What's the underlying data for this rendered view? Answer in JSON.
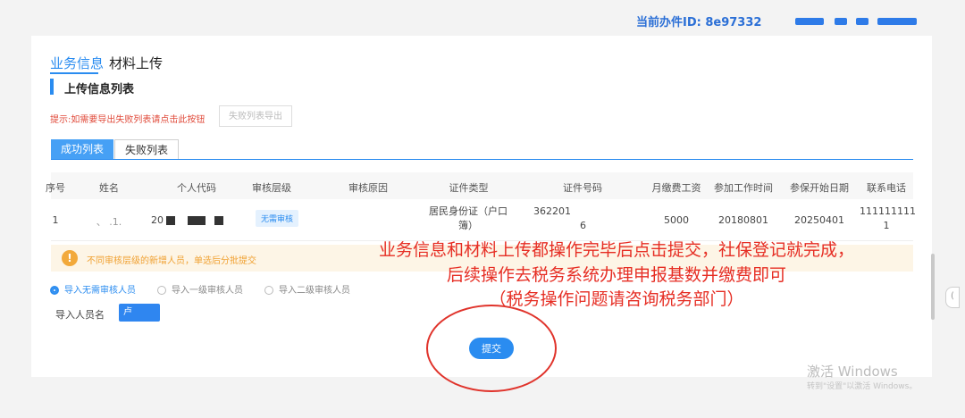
{
  "header": {
    "current_id_label": "当前办件ID: 8e97332",
    "accent_color": "#2a8cf0"
  },
  "tabs": [
    {
      "label": "业务信息",
      "active": true
    },
    {
      "label": "材料上传",
      "active": false
    }
  ],
  "section": {
    "title": "上传信息列表"
  },
  "hint": {
    "text": "提示:如需要导出失败列表请点击此按钮",
    "export_button": "失败列表导出"
  },
  "subtabs": [
    {
      "label": "成功列表",
      "active": true
    },
    {
      "label": "失败列表",
      "active": false
    }
  ],
  "table": {
    "columns": [
      "序号",
      "姓名",
      "个人代码",
      "审核层级",
      "审核原因",
      "证件类型",
      "证件号码",
      "月缴费工资",
      "参加工作时间",
      "参保开始日期",
      "联系电话"
    ],
    "rows": [
      {
        "index": "1",
        "name": "、 .1.",
        "personal_code": "20",
        "audit_level": "无需审核",
        "audit_reason": "",
        "id_type_line1": "居民身份证（户口",
        "id_type_line2": "簿）",
        "id_number_line1": "362201",
        "id_number_line2": "6",
        "monthly_wage": "5000",
        "work_start": "20180801",
        "insure_start": "20250401",
        "phone_line1": "111111111",
        "phone_line2": "1"
      }
    ]
  },
  "warning": {
    "text": "不同审核层级的新增人员，单选后分批提交",
    "icon": "exclamation-icon"
  },
  "radios": [
    {
      "label": "导入无需审核人员",
      "selected": true
    },
    {
      "label": "导入一级审核人员",
      "selected": false
    },
    {
      "label": "导入二级审核人员",
      "selected": false
    }
  ],
  "importer": {
    "label": "导入人员名",
    "value": "卢"
  },
  "submit": {
    "label": "提交"
  },
  "annotation": {
    "line1": "业务信息和材料上传都操作完毕后点击提交，社保登记就完成，",
    "line2": "后续操作去税务系统办理申报基数并缴费即可",
    "line3": "（税务操作问题请咨询税务部门）",
    "color": "#e62e24"
  },
  "watermark": {
    "line1": "激活 Windows",
    "line2": "转到\"设置\"以激活 Windows。"
  }
}
